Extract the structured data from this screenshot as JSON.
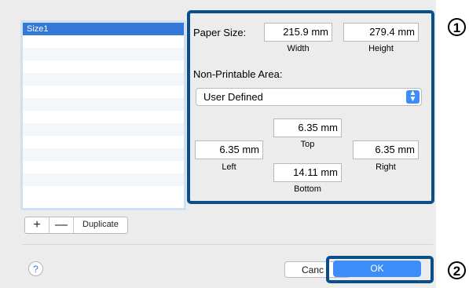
{
  "sizes_list": {
    "items": [
      "Size1",
      "",
      "",
      "",
      "",
      "",
      "",
      "",
      "",
      "",
      "",
      "",
      "",
      "",
      ""
    ]
  },
  "list_controls": {
    "add_label": "+",
    "remove_label": "—",
    "duplicate_label": "Duplicate"
  },
  "paper_size": {
    "label": "Paper Size:",
    "width_value": "215.9 mm",
    "width_label": "Width",
    "height_value": "279.4 mm",
    "height_label": "Height"
  },
  "non_printable": {
    "label": "Non-Printable Area:",
    "selected": "User Defined",
    "top_value": "6.35 mm",
    "top_label": "Top",
    "left_value": "6.35 mm",
    "left_label": "Left",
    "right_value": "6.35 mm",
    "right_label": "Right",
    "bottom_value": "14.11 mm",
    "bottom_label": "Bottom"
  },
  "footer": {
    "help_label": "?",
    "cancel_label": "Canc",
    "ok_label": "OK"
  },
  "callouts": {
    "one": "1",
    "two": "2"
  },
  "colors": {
    "accent": "#3d8df8",
    "highlight_frame": "#0b4f8a",
    "selection": "#3478d8"
  }
}
